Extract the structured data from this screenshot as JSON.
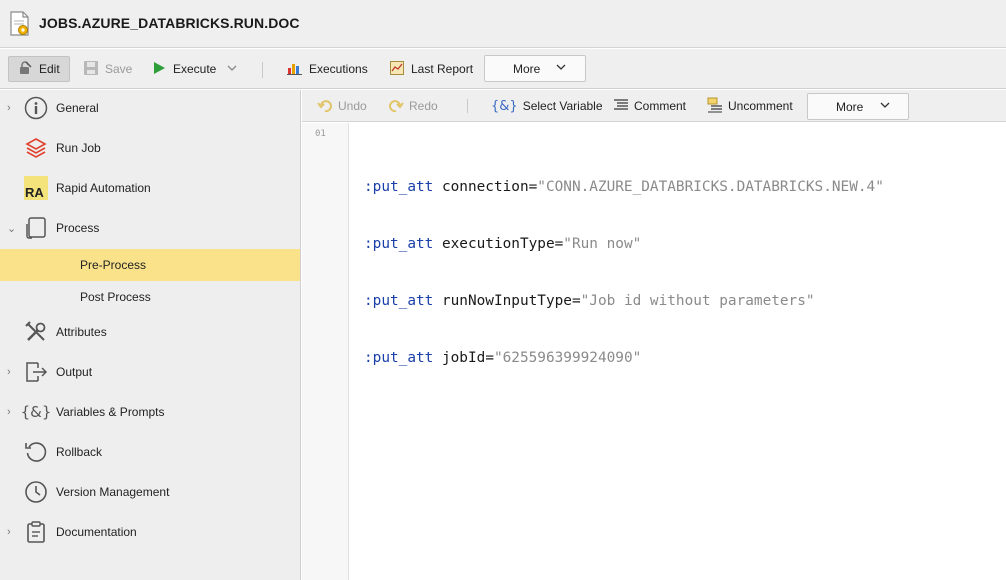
{
  "window": {
    "title": "JOBS.AZURE_DATABRICKS.RUN.DOC",
    "icon": "document-settings-icon"
  },
  "toolbar": {
    "edit_label": "Edit",
    "save_label": "Save",
    "execute_label": "Execute",
    "executions_label": "Executions",
    "last_report_label": "Last Report",
    "more_label": "More"
  },
  "sidebar": {
    "items": [
      {
        "label": "General",
        "icon": "info-icon",
        "has_caret": true
      },
      {
        "label": "Run Job",
        "icon": "databricks-icon",
        "has_caret": false
      },
      {
        "label": "Rapid Automation",
        "icon": "ra-icon",
        "icon_text": "RA",
        "has_caret": false
      },
      {
        "label": "Process",
        "icon": "process-icon",
        "has_caret": true,
        "expanded": true
      },
      {
        "label": "Pre-Process",
        "sub": true,
        "active": true
      },
      {
        "label": "Post Process",
        "sub": true
      },
      {
        "label": "Attributes",
        "icon": "tools-icon",
        "has_caret": false
      },
      {
        "label": "Output",
        "icon": "output-icon",
        "has_caret": true
      },
      {
        "label": "Variables & Prompts",
        "icon": "variables-icon",
        "icon_text": "{&}",
        "has_caret": true
      },
      {
        "label": "Rollback",
        "icon": "rollback-icon",
        "has_caret": false
      },
      {
        "label": "Version Management",
        "icon": "clock-icon",
        "has_caret": false
      },
      {
        "label": "Documentation",
        "icon": "clipboard-icon",
        "has_caret": true
      }
    ]
  },
  "editor_toolbar": {
    "undo_label": "Undo",
    "redo_label": "Redo",
    "select_variable_label": "Select Variable",
    "select_variable_icon_text": "{&}",
    "comment_label": "Comment",
    "uncomment_label": "Uncomment",
    "more_label": "More"
  },
  "editor": {
    "line_number": "01",
    "lines": [
      {
        "keyword": ":put_att",
        "attr": "connection",
        "value": "\"CONN.AZURE_DATABRICKS.DATABRICKS.NEW.4\""
      },
      {
        "keyword": ":put_att",
        "attr": "executionType",
        "value": "\"Run now\""
      },
      {
        "keyword": ":put_att",
        "attr": "runNowInputType",
        "value": "\"Job id without parameters\""
      },
      {
        "keyword": ":put_att",
        "attr": "jobId",
        "value": "\"625596399924090\""
      }
    ]
  },
  "colors": {
    "active_item": "#f9e28a",
    "keyword": "#1a3fa8",
    "string": "#8a8a8a",
    "execute_green": "#2e9e3a",
    "databricks_red": "#e0412d"
  }
}
